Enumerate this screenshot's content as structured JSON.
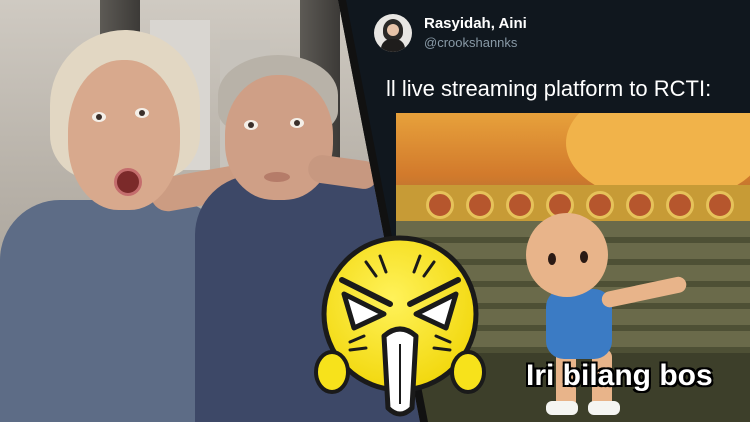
{
  "tweet": {
    "display_name": "Rasyidah, Aini",
    "handle": "@crookshannks",
    "text": "ll live streaming platform to RCTI:"
  },
  "meme": {
    "caption": "Iri bilang bos"
  },
  "colors": {
    "tweet_background": "#10171e",
    "handle_gray": "#8899a6",
    "emoji_yellow": "#f7e21b",
    "divider": "#111111"
  },
  "icons": [
    "avatar",
    "angry-emoji-icon"
  ]
}
